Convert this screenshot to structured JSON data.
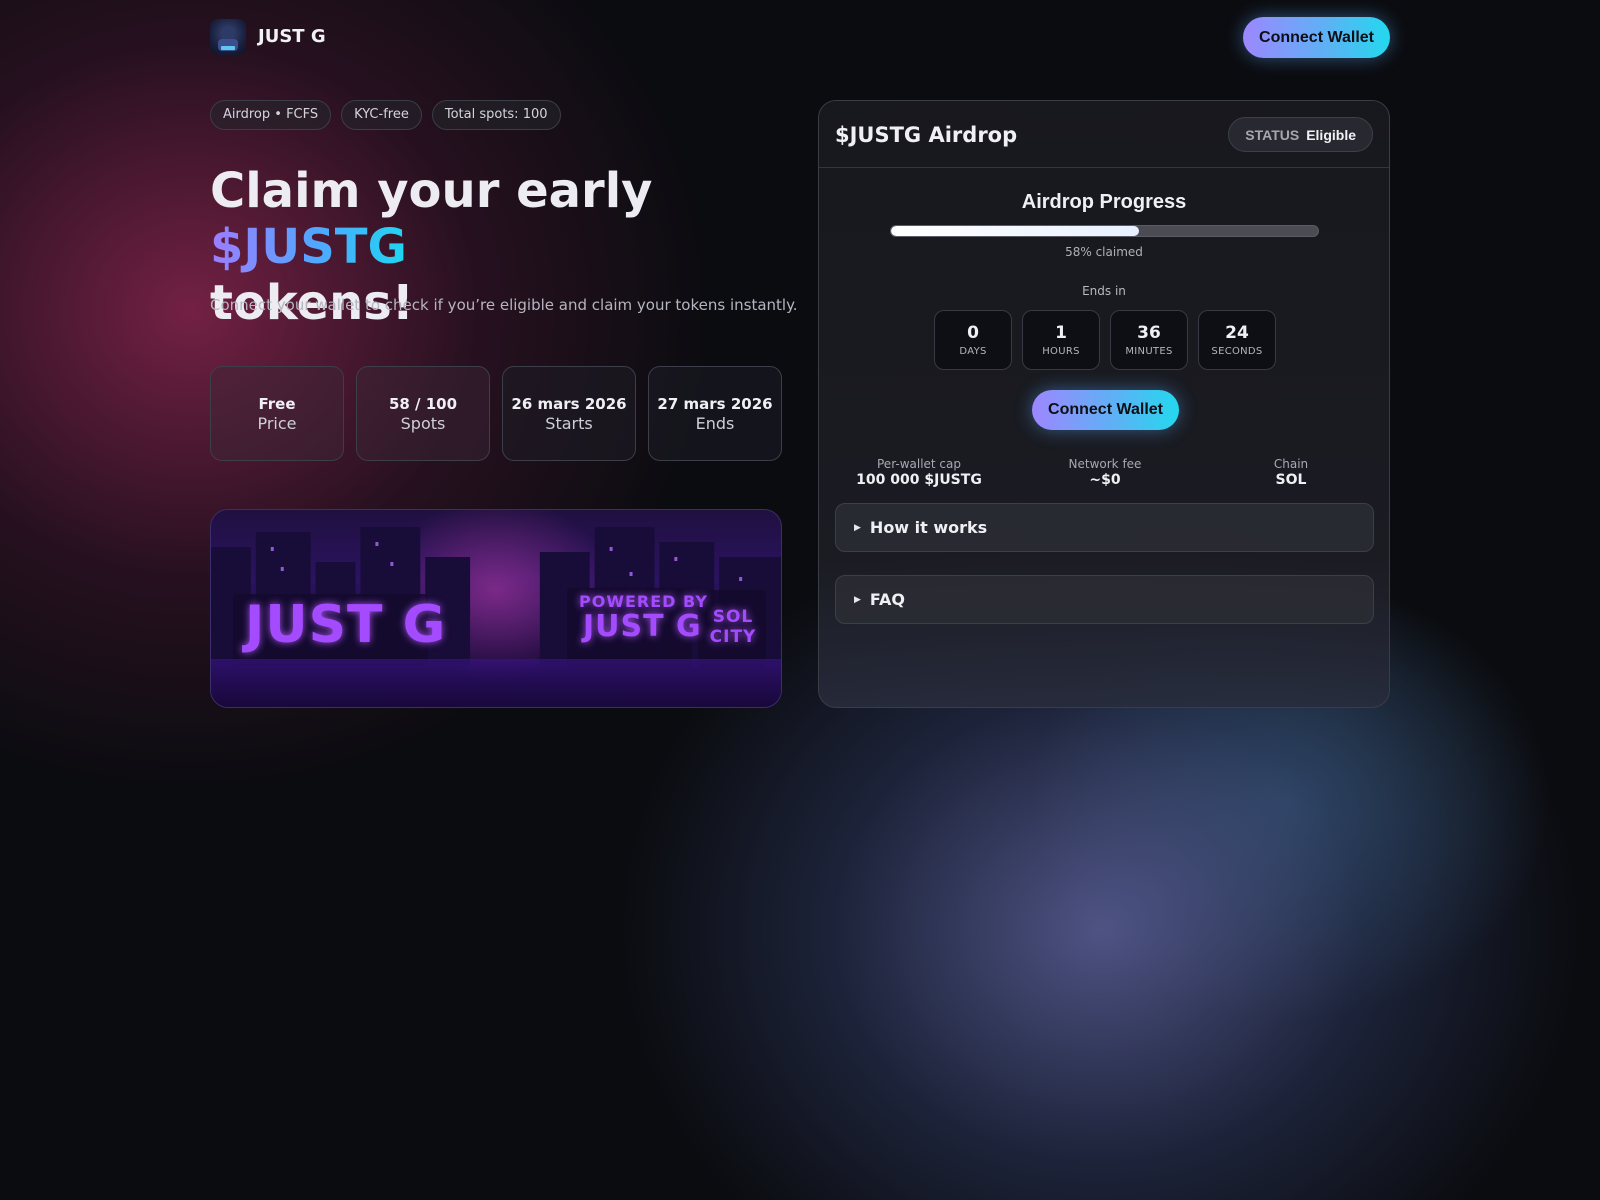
{
  "header": {
    "brand": "JUST G",
    "connect_label": "Connect Wallet"
  },
  "pills": [
    "Airdrop • FCFS",
    "KYC-free",
    "Total spots: 100"
  ],
  "hero": {
    "line1": "Claim your early ",
    "token": "$JUSTG",
    "line2": "tokens!",
    "subtitle": "Connect your wallet to check if you’re eligible and claim your tokens instantly."
  },
  "stats": [
    {
      "value": "Free",
      "label": "Price"
    },
    {
      "value": "58 / 100",
      "label": "Spots"
    },
    {
      "value": "26 mars 2026",
      "label": "Starts"
    },
    {
      "value": "27 mars 2026",
      "label": "Ends"
    }
  ],
  "banner": {
    "graffiti_main": "JUST G",
    "graffiti_powered": "POWERED BY",
    "graffiti_powered_name": "JUST G",
    "graffiti_city": "SOL CITY"
  },
  "card": {
    "title": "$JUSTG Airdrop",
    "status_key": "STATUS",
    "status_value": "Eligible",
    "progress_title": "Airdrop Progress",
    "progress_fraction": 0.58,
    "claimed_text": "58% claimed",
    "ends_label": "Ends in",
    "countdown": [
      {
        "value": "0",
        "unit": "DAYS"
      },
      {
        "value": "1",
        "unit": "HOURS"
      },
      {
        "value": "36",
        "unit": "MINUTES"
      },
      {
        "value": "24",
        "unit": "SECONDS"
      }
    ],
    "connect_label": "Connect Wallet",
    "meta": [
      {
        "key": "Per-wallet cap",
        "value": "100 000 $JUSTG"
      },
      {
        "key": "Network fee",
        "value": "~$0"
      },
      {
        "key": "Chain",
        "value": "SOL"
      }
    ],
    "accordions": [
      "How it works",
      "FAQ"
    ]
  },
  "colors": {
    "accent_start": "#9d87ff",
    "accent_end": "#23d8ee",
    "background": "#0b0c10"
  }
}
